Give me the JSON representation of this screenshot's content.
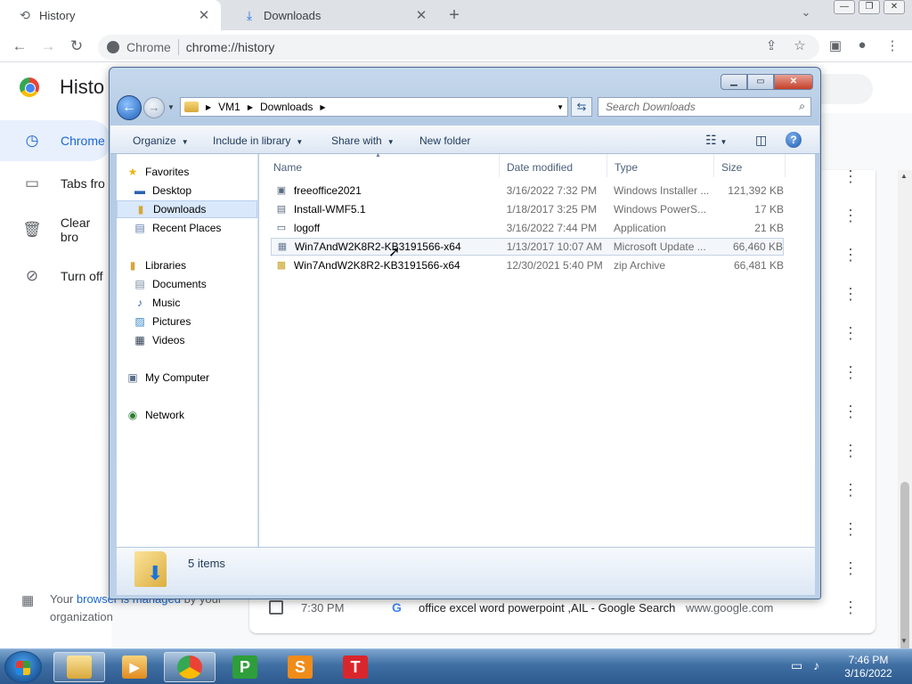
{
  "browser": {
    "tabs": [
      {
        "label": "History",
        "icon": "history-icon"
      },
      {
        "label": "Downloads",
        "icon": "download-icon"
      }
    ],
    "omnibox": {
      "site": "Chrome",
      "url": "chrome://history"
    }
  },
  "history_page": {
    "title": "Histo",
    "sidebar": [
      {
        "label": "Chrome",
        "icon": "history-icon"
      },
      {
        "label": "Tabs fro",
        "icon": "devices-icon"
      },
      {
        "label": "Clear bro",
        "icon": "trash-icon"
      },
      {
        "label": "Turn off",
        "icon": "sync-off-icon"
      }
    ],
    "managed": {
      "pre": "Your ",
      "link": "browser is managed",
      "post": " by your organization"
    },
    "visible_row": {
      "time": "7:30 PM",
      "title": "office excel word powerpoint ,AIL - Google Search",
      "domain": "www.google.com"
    }
  },
  "explorer": {
    "address": {
      "parts": [
        "VM1",
        "Downloads"
      ]
    },
    "search_placeholder": "Search Downloads",
    "commands": {
      "organize": "Organize",
      "include": "Include in library",
      "share": "Share with",
      "new_folder": "New folder"
    },
    "nav": {
      "favorites": "Favorites",
      "desktop": "Desktop",
      "downloads": "Downloads",
      "recent": "Recent Places",
      "libraries": "Libraries",
      "documents": "Documents",
      "music": "Music",
      "pictures": "Pictures",
      "videos": "Videos",
      "computer": "My Computer",
      "network": "Network"
    },
    "columns": {
      "name": "Name",
      "date": "Date modified",
      "type": "Type",
      "size": "Size"
    },
    "files": [
      {
        "name": "freeoffice2021",
        "date": "3/16/2022 7:32 PM",
        "type": "Windows Installer ...",
        "size": "121,392 KB"
      },
      {
        "name": "Install-WMF5.1",
        "date": "1/18/2017 3:25 PM",
        "type": "Windows PowerS...",
        "size": "17 KB"
      },
      {
        "name": "logoff",
        "date": "3/16/2022 7:44 PM",
        "type": "Application",
        "size": "21 KB"
      },
      {
        "name": "Win7AndW2K8R2-KB3191566-x64",
        "date": "1/13/2017 10:07 AM",
        "type": "Microsoft Update ...",
        "size": "66,460 KB"
      },
      {
        "name": "Win7AndW2K8R2-KB3191566-x64",
        "date": "12/30/2021 5:40 PM",
        "type": "zip Archive",
        "size": "66,481 KB"
      }
    ],
    "status": "5 items"
  },
  "taskbar": {
    "apps": [
      {
        "label": "P",
        "color": "#2e9e3a"
      },
      {
        "label": "S",
        "color": "#f08c1a"
      },
      {
        "label": "T",
        "color": "#d9262c"
      }
    ],
    "clock": {
      "time": "7:46 PM",
      "date": "3/16/2022"
    }
  }
}
